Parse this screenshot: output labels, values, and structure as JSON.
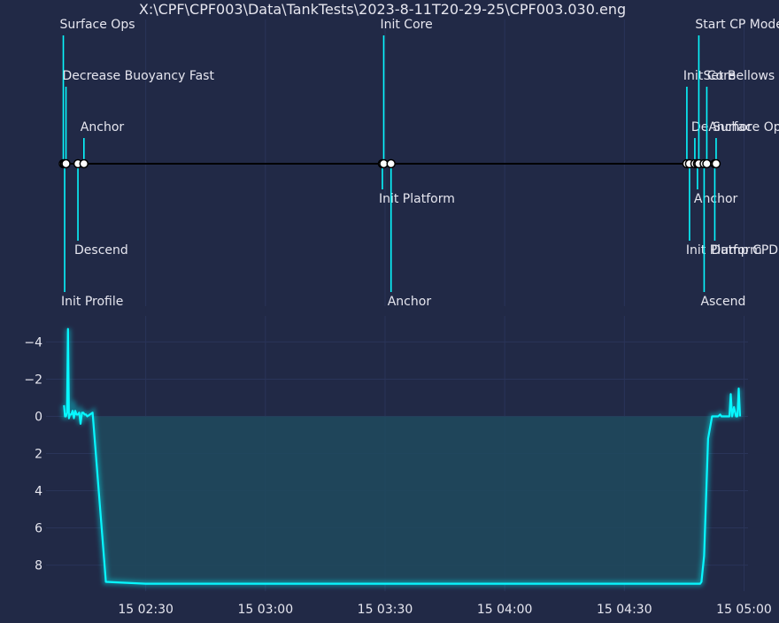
{
  "title": "X:\\CPF\\CPF003\\Data\\TankTests\\2023-8-11T20-29-25\\CPF003.030.eng",
  "colors": {
    "background": "#212946",
    "grid": "#2A3459",
    "accent": "#08F7FE",
    "fill": "#1f4a5e",
    "timeline": "#000000",
    "text": "#e6e6ef"
  },
  "chart_data": [
    {
      "type": "timeline",
      "events": [
        {
          "label": "Surface Ops",
          "t": "02:09:20"
        },
        {
          "label": "Init Profile",
          "t": "02:09:40"
        },
        {
          "label": "Decrease Buoyancy Fast",
          "t": "02:10:00"
        },
        {
          "label": "Descend",
          "t": "02:13:00"
        },
        {
          "label": "Anchor",
          "t": "02:14:30"
        },
        {
          "label": "Init Platform",
          "t": "03:29:20"
        },
        {
          "label": "Init Core",
          "t": "03:29:40"
        },
        {
          "label": "Anchor",
          "t": "03:31:30"
        },
        {
          "label": "Init Core",
          "t": "04:45:40"
        },
        {
          "label": "Init Platform",
          "t": "04:46:20"
        },
        {
          "label": "DeAnchor",
          "t": "04:47:40"
        },
        {
          "label": "Anchor",
          "t": "04:48:20"
        },
        {
          "label": "Start CP Mode",
          "t": "04:48:40"
        },
        {
          "label": "Ascend",
          "t": "04:50:00"
        },
        {
          "label": "Set Bellows",
          "t": "04:50:40"
        },
        {
          "label": "Dump CPData",
          "t": "04:52:40"
        },
        {
          "label": "Surface Ops",
          "t": "04:53:00"
        }
      ]
    },
    {
      "type": "line",
      "x_ticks": [
        "15 02:30",
        "15 03:00",
        "15 03:30",
        "15 04:00",
        "15 04:30",
        "15 05:00"
      ],
      "y_ticks": [
        "−4",
        "−2",
        "0",
        "2",
        "4",
        "6",
        "8"
      ],
      "y_tick_values": [
        -4,
        -2,
        0,
        2,
        4,
        6,
        8
      ],
      "ylim": [
        9.4,
        -5.4
      ],
      "y_inverted": true,
      "grid": true,
      "fill_to_zero": true,
      "series": [
        {
          "x": [
            "02:09:30",
            "02:09:45",
            "02:10:00",
            "02:10:15",
            "02:10:30",
            "02:10:45",
            "02:11:00",
            "02:11:20",
            "02:11:40",
            "02:12:00",
            "02:12:20",
            "02:12:40",
            "02:13:00",
            "02:13:20",
            "02:13:40",
            "02:14:00",
            "02:14:20",
            "02:14:40",
            "02:15:00",
            "02:15:20",
            "02:16:00",
            "02:16:40",
            "02:20:00",
            "02:30:00",
            "03:00:00",
            "03:30:00",
            "04:00:00",
            "04:30:00",
            "04:45:00",
            "04:47:00",
            "04:47:40",
            "04:48:00",
            "04:48:20",
            "04:48:40",
            "04:49:00",
            "04:49:20",
            "04:50:00",
            "04:51:00",
            "04:52:00",
            "04:53:00",
            "04:53:30",
            "04:54:00",
            "04:54:20",
            "04:54:40",
            "04:55:00",
            "04:55:20",
            "04:55:40",
            "04:56:00",
            "04:56:20",
            "04:56:40",
            "04:57:00",
            "04:57:30",
            "04:58:00",
            "04:58:20",
            "04:58:40",
            "04:59:00"
          ],
          "y": [
            -0.6,
            0.0,
            0.0,
            -0.2,
            -4.7,
            0.1,
            -0.1,
            -0.1,
            -0.3,
            0.1,
            -0.3,
            -0.1,
            -0.1,
            -0.2,
            0.4,
            -0.2,
            -0.2,
            -0.1,
            -0.1,
            0.0,
            -0.1,
            -0.2,
            8.9,
            9.0,
            9.0,
            9.0,
            9.0,
            9.0,
            9.0,
            9.0,
            9.0,
            9.0,
            9.0,
            9.0,
            9.0,
            8.9,
            7.5,
            1.2,
            0.0,
            0.0,
            0.0,
            -0.1,
            0.0,
            0.0,
            0.0,
            0.0,
            0.0,
            0.0,
            0.0,
            -1.2,
            0.0,
            -0.5,
            0.0,
            0.0,
            -1.5,
            0.0
          ]
        }
      ]
    }
  ]
}
